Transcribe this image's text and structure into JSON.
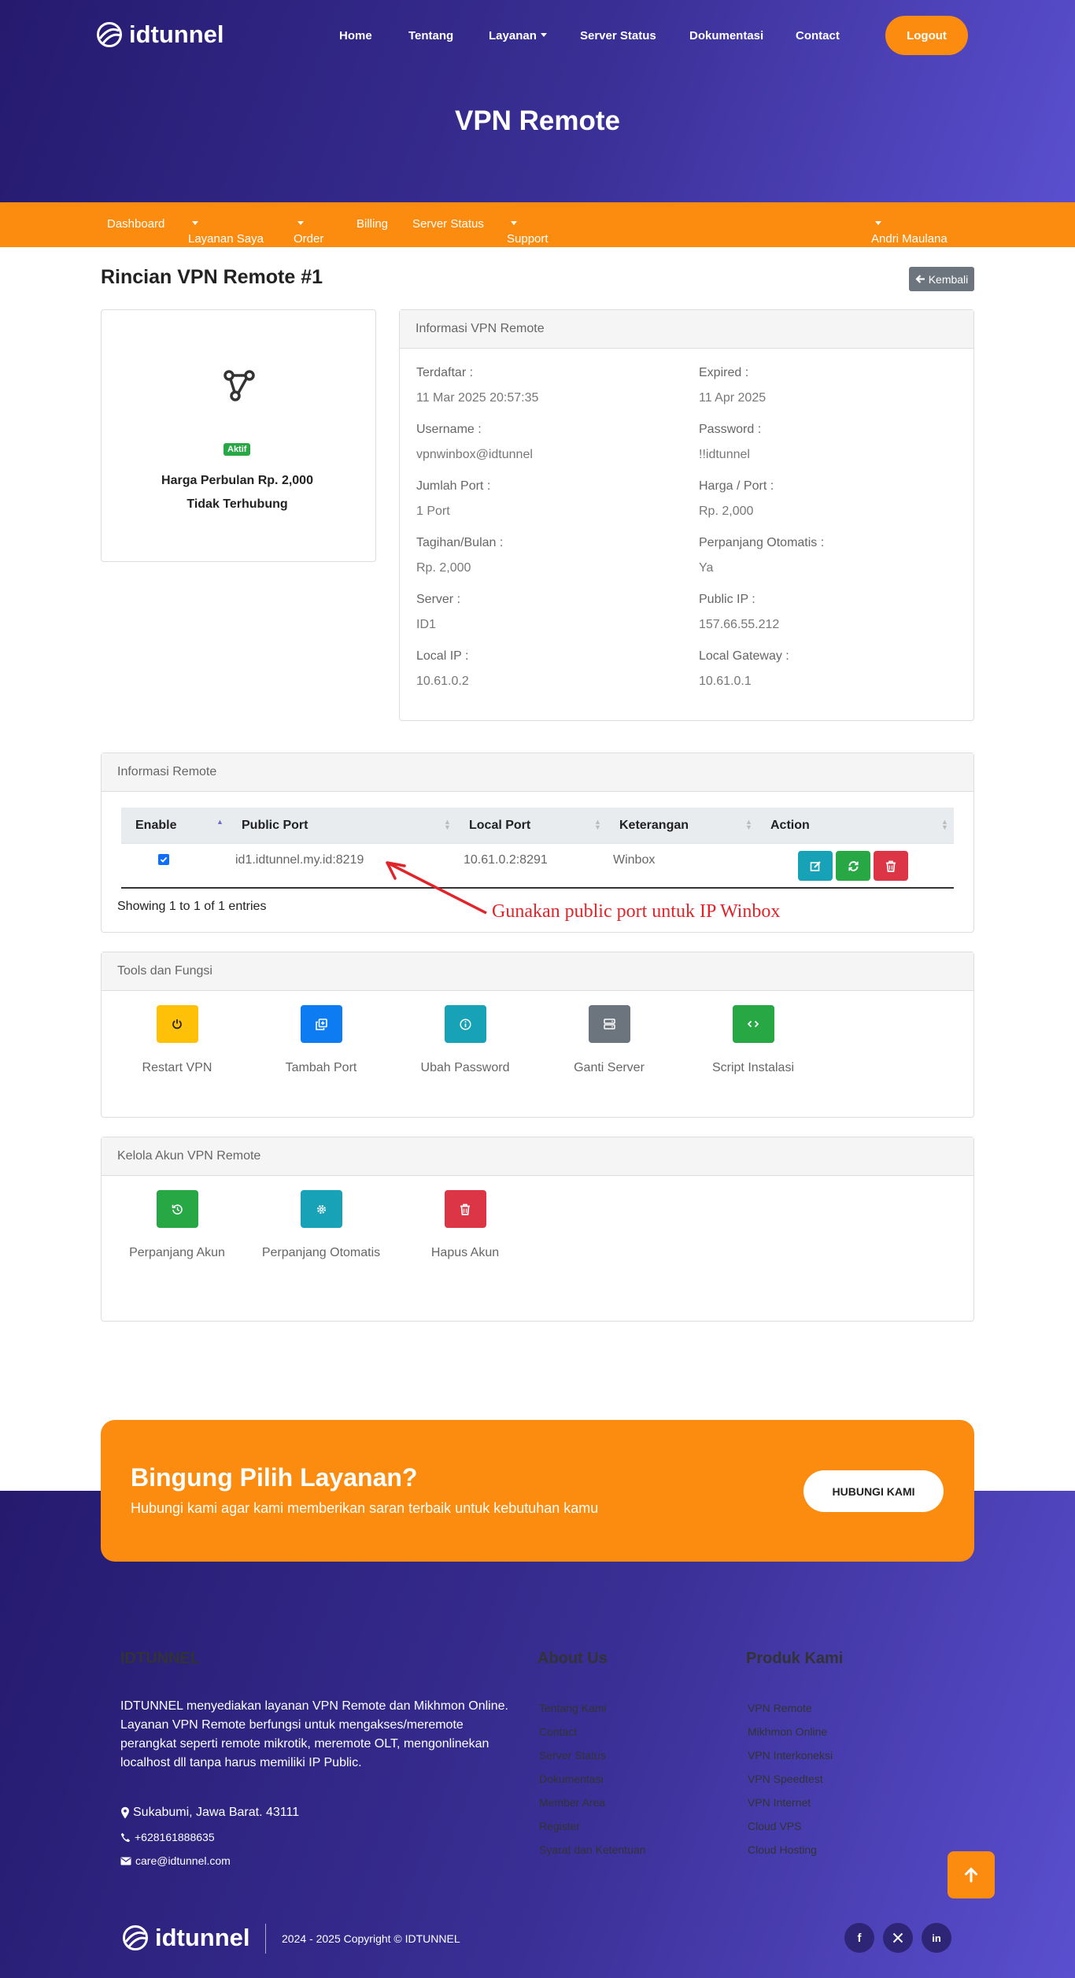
{
  "brand": {
    "name": "idtunnel"
  },
  "topnav": {
    "home": "Home",
    "about": "Tentang",
    "services": "Layanan",
    "server_status": "Server Status",
    "docs": "Dokumentasi",
    "contact": "Contact",
    "logout": "Logout"
  },
  "hero": {
    "title": "VPN Remote"
  },
  "subnav": {
    "dashboard": "Dashboard",
    "my_services": "Layanan Saya",
    "order": "Order",
    "billing": "Billing",
    "server_status": "Server Status",
    "support": "Support",
    "user": "Andri Maulana"
  },
  "page": {
    "title": "Rincian VPN Remote #1",
    "back_label": "Kembali"
  },
  "summary": {
    "status_badge": "Aktif",
    "price_text": "Harga Perbulan Rp. 2,000",
    "connection_text": "Tidak Terhubung"
  },
  "info": {
    "title": "Informasi VPN Remote",
    "fields": [
      {
        "label": "Terdaftar :",
        "value": "11 Mar 2025 20:57:35"
      },
      {
        "label": "Expired :",
        "value": "11 Apr 2025"
      },
      {
        "label": "Username :",
        "value": "vpnwinbox@idtunnel"
      },
      {
        "label": "Password :",
        "value": "!!idtunnel"
      },
      {
        "label": "Jumlah Port :",
        "value": "1 Port"
      },
      {
        "label": "Harga / Port :",
        "value": "Rp. 2,000"
      },
      {
        "label": "Tagihan/Bulan :",
        "value": "Rp. 2,000"
      },
      {
        "label": "Perpanjang Otomatis :",
        "value": "Ya"
      },
      {
        "label": "Server :",
        "value": "ID1"
      },
      {
        "label": "Public IP :",
        "value": "157.66.55.212"
      },
      {
        "label": "Local IP :",
        "value": "10.61.0.2"
      },
      {
        "label": "Local Gateway :",
        "value": "10.61.0.1"
      }
    ]
  },
  "remote": {
    "title": "Informasi Remote",
    "columns": [
      "Enable",
      "Public Port",
      "Local Port",
      "Keterangan",
      "Action"
    ],
    "rows": [
      {
        "enabled": true,
        "public_port": "id1.idtunnel.my.id:8219",
        "local_port": "10.61.0.2:8291",
        "note": "Winbox"
      }
    ],
    "showing": "Showing 1 to 1 of 1 entries",
    "annotation": "Gunakan public port untuk IP Winbox"
  },
  "tools": {
    "title": "Tools dan Fungsi",
    "items": [
      {
        "label": "Restart VPN",
        "icon": "power-icon",
        "color": "#ffc107"
      },
      {
        "label": "Tambah Port",
        "icon": "copy-plus-icon",
        "color": "#0d7cf2"
      },
      {
        "label": "Ubah Password",
        "icon": "info-icon",
        "color": "#17a2b8"
      },
      {
        "label": "Ganti Server",
        "icon": "server-icon",
        "color": "#6c757d"
      },
      {
        "label": "Script Instalasi",
        "icon": "code-icon",
        "color": "#28a745"
      }
    ]
  },
  "manage": {
    "title": "Kelola Akun VPN Remote",
    "items": [
      {
        "label": "Perpanjang Akun",
        "icon": "renew-icon",
        "color": "#28a745"
      },
      {
        "label": "Perpanjang Otomatis",
        "icon": "gear-icon",
        "color": "#17a2b8"
      },
      {
        "label": "Hapus Akun",
        "icon": "trash-icon",
        "color": "#dc3545"
      }
    ]
  },
  "cta": {
    "title": "Bingung Pilih Layanan?",
    "subtitle": "Hubungi kami agar kami memberikan saran terbaik untuk kebutuhan kamu",
    "button": "HUBUNGI KAMI"
  },
  "footer": {
    "about_title": "IDTUNNEL",
    "about_text": "IDTUNNEL menyediakan layanan VPN Remote dan Mikhmon Online. Layanan VPN Remote berfungsi untuk mengakses/meremote perangkat seperti remote mikrotik, meremote OLT, mengonlinekan localhost dll tanpa harus memiliki IP Public.",
    "address": "Sukabumi, Jawa Barat. 43111",
    "phone": "+628161888635",
    "email": "care@idtunnel.com",
    "about_us_title": "About Us",
    "about_us_links": [
      "Tentang Kami",
      "Contact",
      "Server Status",
      "Dokumentasi",
      "Member Area",
      "Register",
      "Syarat dan Ketentuan"
    ],
    "products_title": "Produk Kami",
    "products_links": [
      "VPN Remote",
      "Mikhmon Online",
      "VPN Interkoneksi",
      "VPN Speedtest",
      "VPN Internet",
      "Cloud VPS",
      "Cloud Hosting"
    ],
    "copyright": "2024 - 2025 Copyright © IDTUNNEL"
  }
}
